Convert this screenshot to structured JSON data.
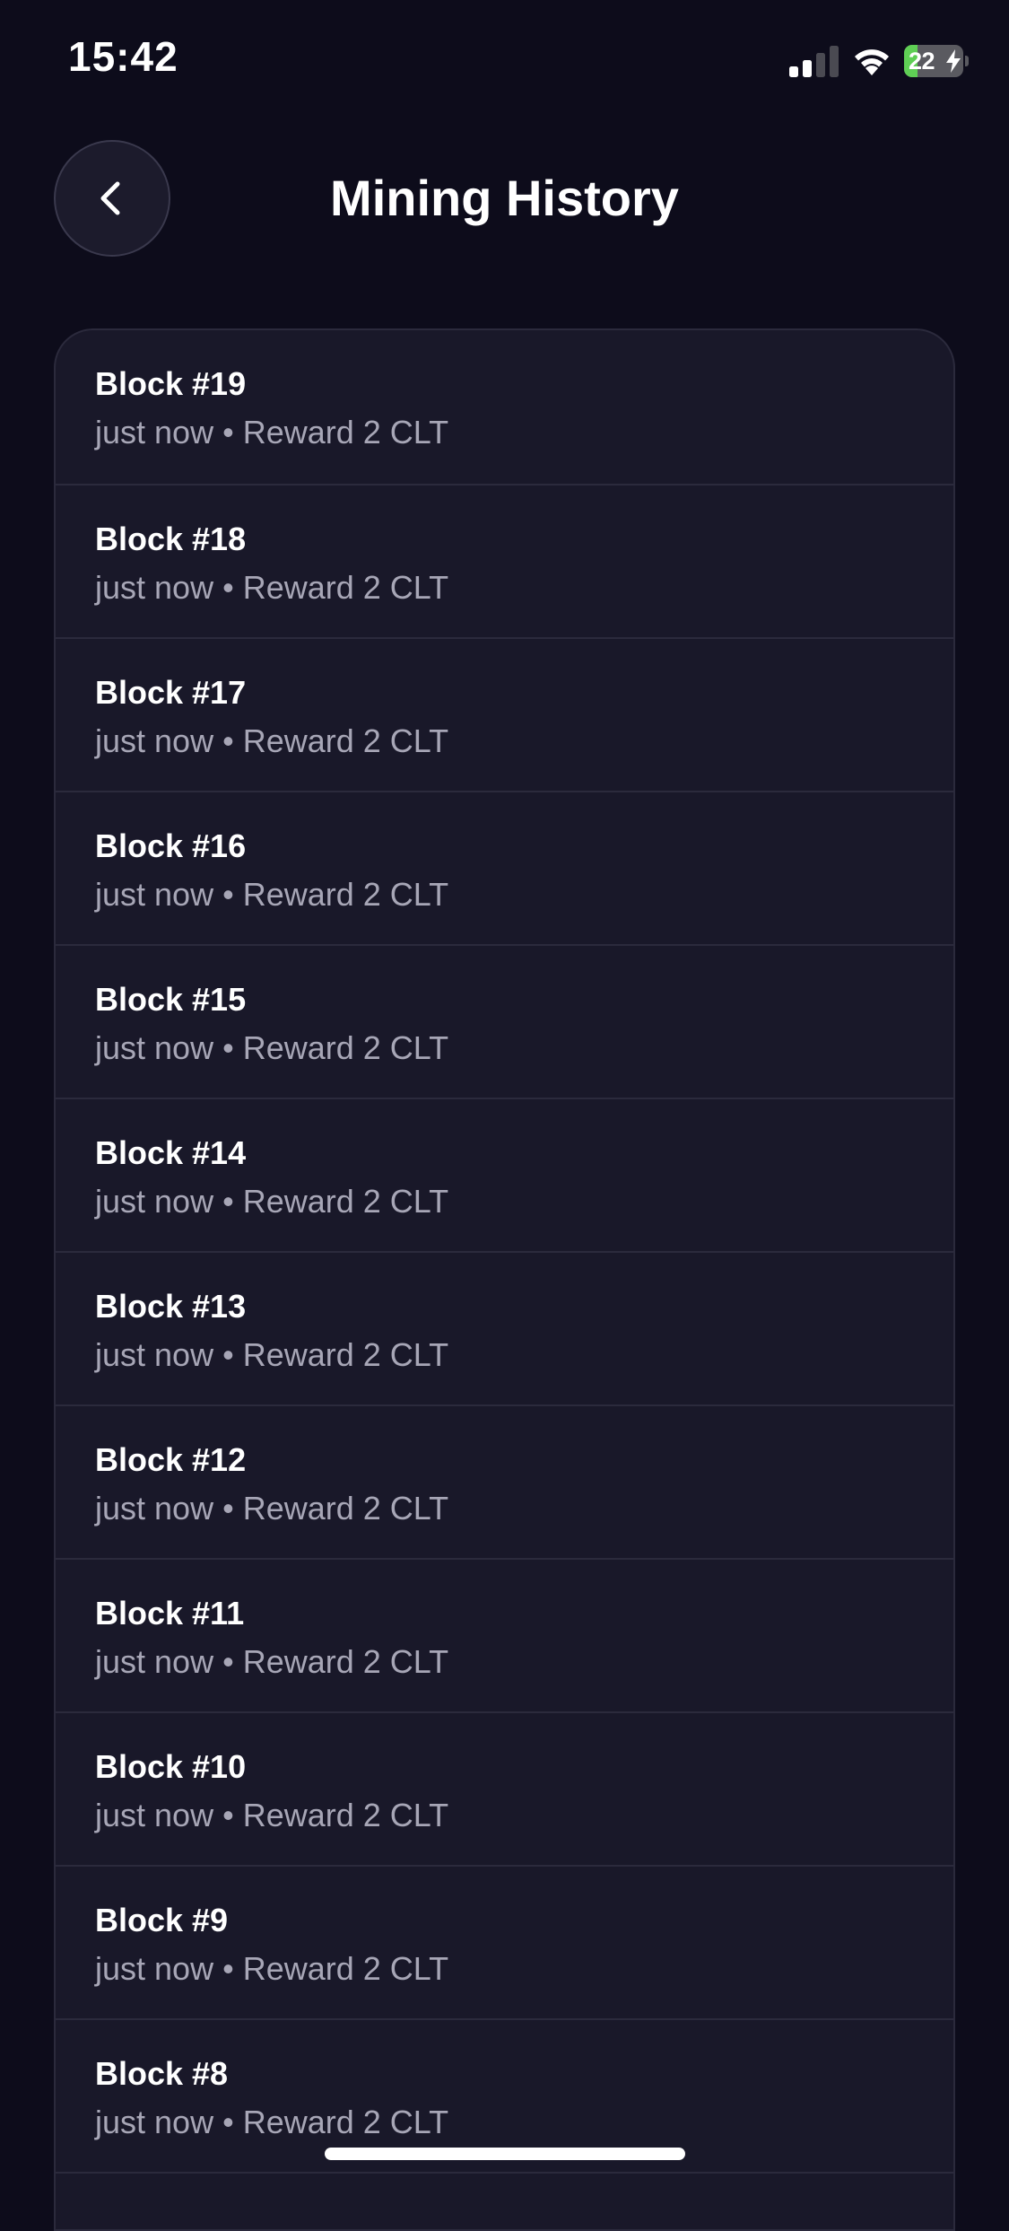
{
  "status_bar": {
    "time": "15:42",
    "battery_level": "22",
    "battery_fraction": 0.22,
    "colors": {
      "battery_fill": "#5fcf55"
    }
  },
  "header": {
    "back_icon": "chevron-left-icon",
    "title": "Mining History"
  },
  "history": {
    "items": [
      {
        "title": "Block #19",
        "time": "just now",
        "separator": "•",
        "reward": "Reward 2 CLT"
      },
      {
        "title": "Block #18",
        "time": "just now",
        "separator": "•",
        "reward": "Reward 2 CLT"
      },
      {
        "title": "Block #17",
        "time": "just now",
        "separator": "•",
        "reward": "Reward 2 CLT"
      },
      {
        "title": "Block #16",
        "time": "just now",
        "separator": "•",
        "reward": "Reward 2 CLT"
      },
      {
        "title": "Block #15",
        "time": "just now",
        "separator": "•",
        "reward": "Reward 2 CLT"
      },
      {
        "title": "Block #14",
        "time": "just now",
        "separator": "•",
        "reward": "Reward 2 CLT"
      },
      {
        "title": "Block #13",
        "time": "just now",
        "separator": "•",
        "reward": "Reward 2 CLT"
      },
      {
        "title": "Block #12",
        "time": "just now",
        "separator": "•",
        "reward": "Reward 2 CLT"
      },
      {
        "title": "Block #11",
        "time": "just now",
        "separator": "•",
        "reward": "Reward 2 CLT"
      },
      {
        "title": "Block #10",
        "time": "just now",
        "separator": "•",
        "reward": "Reward 2 CLT"
      },
      {
        "title": "Block #9",
        "time": "just now",
        "separator": "•",
        "reward": "Reward 2 CLT"
      },
      {
        "title": "Block #8",
        "time": "just now",
        "separator": "•",
        "reward": "Reward 2 CLT"
      },
      {
        "title": "",
        "time": "",
        "separator": "",
        "reward": ""
      }
    ]
  },
  "colors": {
    "background": "#0d0c1b",
    "card": "#191829",
    "divider": "#2b2a3c",
    "secondary_text": "#a7a6b6"
  }
}
